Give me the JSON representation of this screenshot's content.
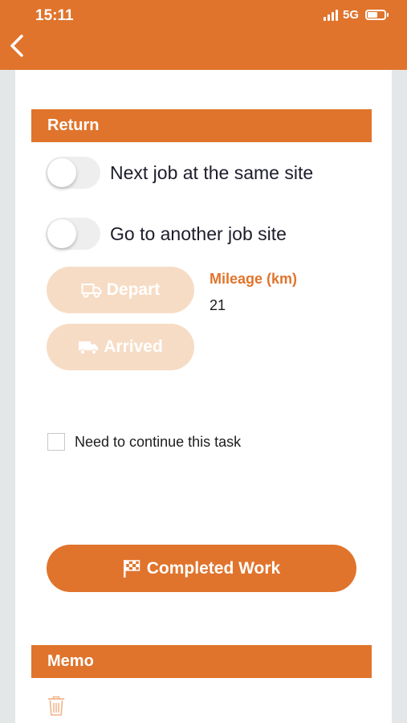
{
  "status_bar": {
    "time": "15:11",
    "network": "5G",
    "icons": [
      "signal-icon",
      "battery-icon"
    ]
  },
  "header": {
    "back_icon": "chevron-left-icon"
  },
  "return_section": {
    "title": "Return",
    "toggles": [
      {
        "label": "Next job at the same site",
        "on": false
      },
      {
        "label": "Go to another job site",
        "on": false
      }
    ],
    "depart_label": "Depart",
    "depart_icon": "truck-outline-icon",
    "arrived_label": "Arrived",
    "arrived_icon": "truck-icon",
    "mileage_label": "Mileage (km)",
    "mileage_value": "21",
    "continue_label": "Need to continue this task",
    "continue_checked": false,
    "complete_label": "Completed Work",
    "complete_icon": "checkered-flag-icon"
  },
  "memo_section": {
    "title": "Memo",
    "delete_icon": "trash-icon"
  },
  "colors": {
    "accent": "#e0742c",
    "accent_light": "#f7dcc5",
    "background": "#e4e7e8"
  }
}
